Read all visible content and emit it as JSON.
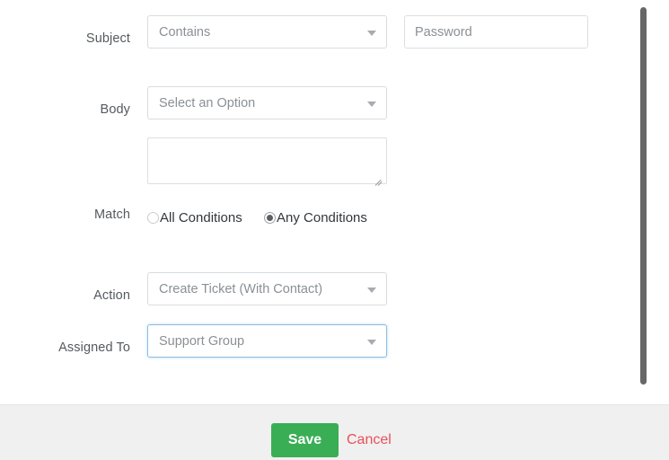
{
  "form": {
    "rows": [
      {
        "label": "Subject",
        "control": "select",
        "value": "Contains",
        "caret_icon": "chevron-down-icon",
        "extra_input": {
          "name": "subject-value-input",
          "value": "Password",
          "placeholder": "Password"
        }
      },
      {
        "label": "Body",
        "control": "select",
        "value": "Select an Option",
        "caret_icon": "chevron-down-icon"
      },
      {
        "label": "",
        "control": "textarea",
        "value": "",
        "placeholder": ""
      },
      {
        "label": "Match",
        "control": "radio",
        "options": [
          {
            "label": "All Conditions",
            "checked": false
          },
          {
            "label": "Any Conditions",
            "checked": true
          }
        ]
      },
      {
        "label": "Action",
        "control": "select",
        "value": "Create Ticket (With Contact)",
        "caret_icon": "chevron-down-icon"
      },
      {
        "label": "Assigned To",
        "control": "select",
        "value": "Support Group",
        "caret_icon": "chevron-down-icon",
        "focused": true
      }
    ]
  },
  "footer": {
    "save_label": "Save",
    "cancel_label": "Cancel"
  },
  "colors": {
    "save_green": "#3aae55",
    "cancel_red": "#e8505b",
    "focus_blue": "#8fbde0",
    "footer_bg": "#f0f0f0",
    "scrollbar_thumb": "#676767"
  }
}
